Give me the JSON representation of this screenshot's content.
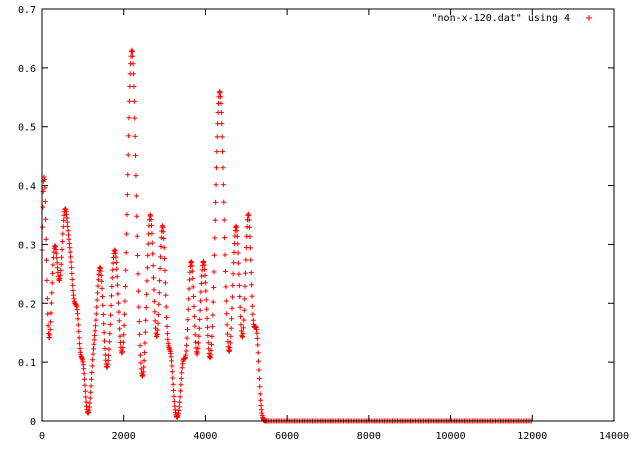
{
  "chart_data": {
    "type": "scatter",
    "title": "",
    "xlabel": "",
    "ylabel": "",
    "xlim": [
      0,
      14000
    ],
    "ylim": [
      0,
      0.7
    ],
    "xticks": [
      0,
      2000,
      4000,
      6000,
      8000,
      10000,
      12000,
      14000
    ],
    "yticks": [
      0,
      0.1,
      0.2,
      0.3,
      0.4,
      0.5,
      0.6,
      0.7
    ],
    "xtick_labels": [
      "0",
      "2000",
      "4000",
      "6000",
      "8000",
      "10000",
      "12000",
      "14000"
    ],
    "ytick_labels": [
      "0",
      "0.1",
      "0.2",
      "0.3",
      "0.4",
      "0.5",
      "0.6",
      "0.7"
    ],
    "grid": false,
    "legend": {
      "position": "top-right",
      "label": "\"non-x-120.dat\" using 4",
      "marker": "+"
    },
    "series": [
      {
        "name": "\"non-x-120.dat\" using 4",
        "color": "#ff0000",
        "marker": "+",
        "peaks": [
          {
            "center": 50,
            "height": 0.41,
            "width": 60
          },
          {
            "center": 310,
            "height": 0.29,
            "width": 90
          },
          {
            "center": 560,
            "height": 0.34,
            "width": 90
          },
          {
            "center": 720,
            "height": 0.18,
            "width": 70
          },
          {
            "center": 860,
            "height": 0.16,
            "width": 60
          },
          {
            "center": 1000,
            "height": 0.09,
            "width": 55
          },
          {
            "center": 1250,
            "height": 0.07,
            "width": 55
          },
          {
            "center": 1420,
            "height": 0.26,
            "width": 90
          },
          {
            "center": 1780,
            "height": 0.29,
            "width": 100
          },
          {
            "center": 2200,
            "height": 0.63,
            "width": 110
          },
          {
            "center": 2650,
            "height": 0.35,
            "width": 90
          },
          {
            "center": 2950,
            "height": 0.33,
            "width": 80
          },
          {
            "center": 3150,
            "height": 0.1,
            "width": 60
          },
          {
            "center": 3450,
            "height": 0.09,
            "width": 55
          },
          {
            "center": 3650,
            "height": 0.27,
            "width": 80
          },
          {
            "center": 3950,
            "height": 0.27,
            "width": 90
          },
          {
            "center": 4350,
            "height": 0.56,
            "width": 110
          },
          {
            "center": 4750,
            "height": 0.33,
            "width": 90
          },
          {
            "center": 5050,
            "height": 0.35,
            "width": 80
          },
          {
            "center": 5250,
            "height": 0.14,
            "width": 60
          }
        ],
        "flat_from": 5500,
        "flat_to": 12000,
        "flat_value": 0,
        "step": 10
      }
    ]
  }
}
